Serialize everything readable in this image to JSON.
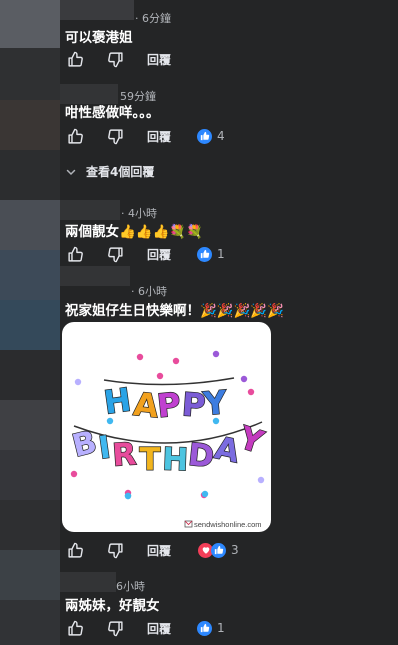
{
  "comments": [
    {
      "timestamp": "· 6分鐘",
      "text": "可以褒港姐",
      "reply_label": "回覆",
      "reaction_count": ""
    },
    {
      "timestamp": "59分鐘",
      "text": "咁性感做咩。。。",
      "reply_label": "回覆",
      "reaction_count": "4"
    },
    {
      "timestamp": "· 4小時",
      "text": "兩個靚女👍👍👍💐💐",
      "reply_label": "回覆",
      "reaction_count": "1"
    },
    {
      "timestamp": "· 6小時",
      "text": "祝家姐仔生日快樂啊！🎉🎉🎉🎉🎉",
      "reply_label": "回覆",
      "reaction_count": "3"
    },
    {
      "timestamp": "6小時",
      "text": "兩姊妹，好靚女",
      "reply_label": "回覆",
      "reaction_count": "1"
    }
  ],
  "view_replies_label": "查看4個回覆",
  "birthday_card": {
    "word1": [
      "H",
      "A",
      "P",
      "P",
      "Y"
    ],
    "word2": [
      "B",
      "I",
      "R",
      "T",
      "H",
      "D",
      "A",
      "Y"
    ],
    "watermark": "sendwishonline.com"
  },
  "colors": {
    "background": "#242526",
    "like_blue": "#2d88ff",
    "love_red": "#f33e58",
    "secondary_text": "#b0b3b8"
  },
  "icons": {
    "like": "thumbs-up-icon",
    "dislike": "thumbs-down-icon",
    "expand": "chevron-down-icon",
    "like_reaction": "like-reaction-icon",
    "love_reaction": "love-reaction-icon"
  }
}
